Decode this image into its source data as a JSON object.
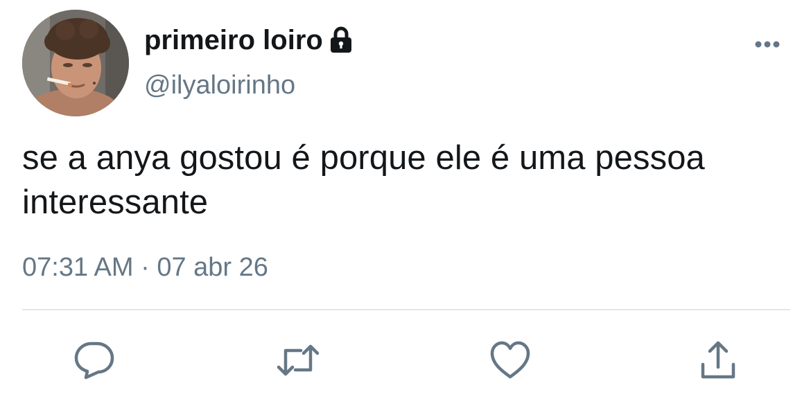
{
  "tweet": {
    "author": {
      "display_name": "primeiro loiro",
      "handle": "@ilyaloirinho",
      "protected_icon": "lock-icon",
      "avatar": "profile-photo"
    },
    "text": "se a anya gostou é porque ele é uma pessoa interessante",
    "time": "07:31 AM",
    "separator": "·",
    "date": "07 abr 26",
    "menu_icon": "more-dots-icon",
    "actions": [
      {
        "name": "reply",
        "icon": "reply-icon"
      },
      {
        "name": "retweet",
        "icon": "retweet-icon"
      },
      {
        "name": "like",
        "icon": "heart-icon"
      },
      {
        "name": "share",
        "icon": "share-icon"
      }
    ]
  },
  "colors": {
    "text_primary": "#14171a",
    "text_secondary": "#657786",
    "divider": "#e1e8ed",
    "icon": "#657786",
    "background": "#ffffff"
  }
}
